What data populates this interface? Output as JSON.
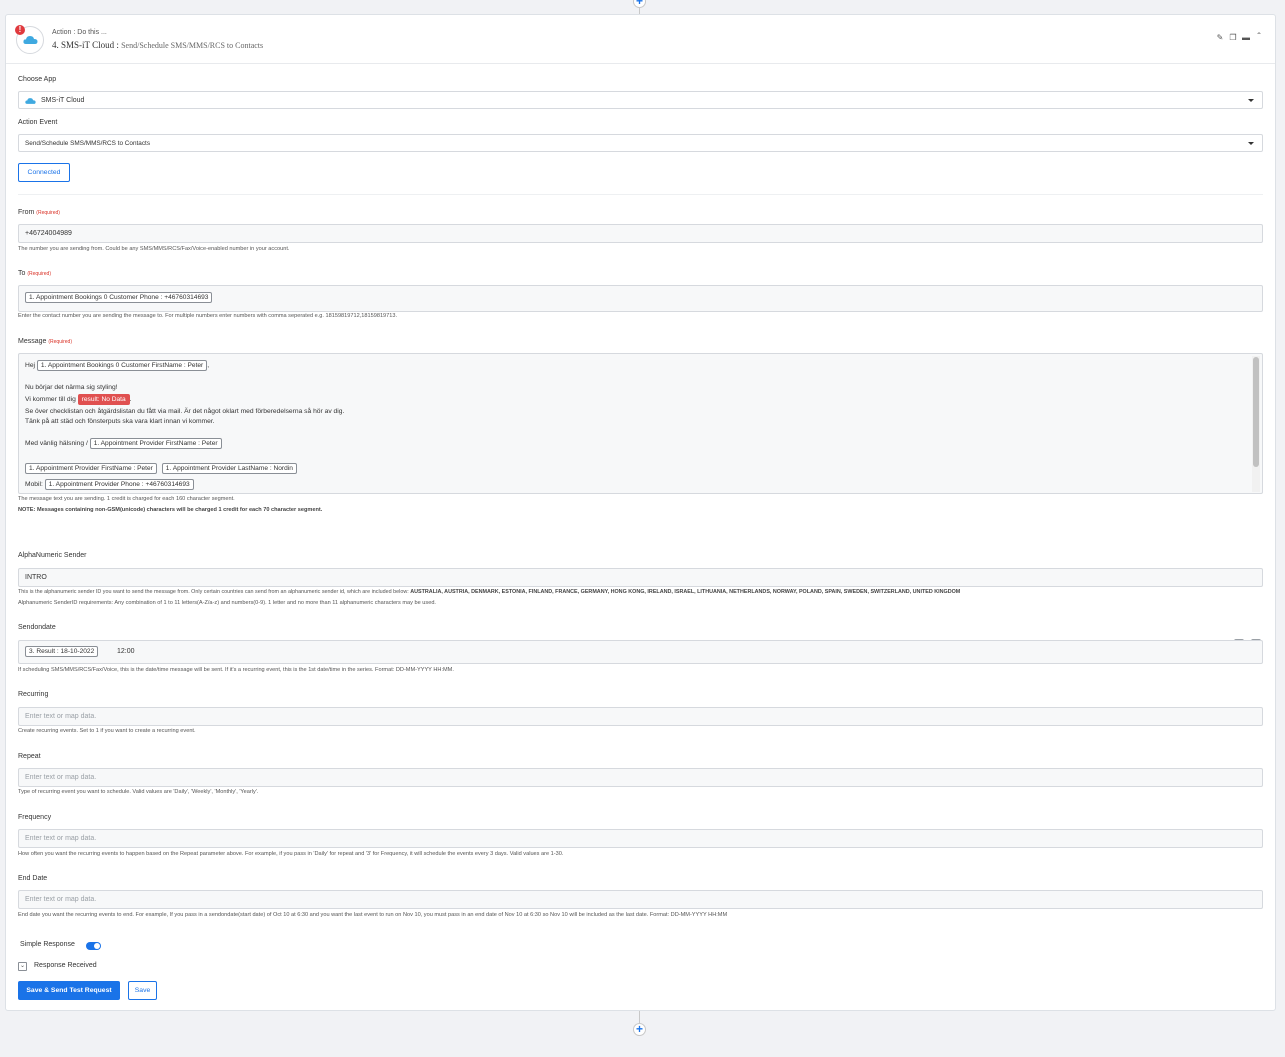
{
  "header": {
    "subtitle": "Action : Do this ...",
    "step_title": "4. SMS-iT Cloud :",
    "event_title": "Send/Schedule SMS/MMS/RCS to Contacts",
    "alert": "!"
  },
  "colors": {
    "accent": "#1a73e8",
    "error": "#e05050",
    "required": "#d93025"
  },
  "icons": {
    "logo": "cloud-icon",
    "edit": "pencil-icon",
    "copy": "copy-icon",
    "delete": "trash-icon",
    "collapse": "chevron-up-icon",
    "add": "plus-icon"
  },
  "choose_app": {
    "label": "Choose App",
    "value": "SMS-iT Cloud"
  },
  "action_event": {
    "label": "Action Event",
    "value": "Send/Schedule SMS/MMS/RCS to Contacts"
  },
  "connected_label": "Connected",
  "required_label": "(Required)",
  "from": {
    "label": "From",
    "value": "+46724004989",
    "hint": "The number you are sending from. Could be any SMS/MMS/RCS/Fax/Voice-enabled number in your account."
  },
  "to": {
    "label": "To",
    "pill": "1. Appointment Bookings 0 Customer Phone : +46760314693",
    "hint": "Enter the contact number you are sending the message to. For multiple numbers enter numbers with comma seperated e.g. 18159819712,18159819713."
  },
  "message": {
    "label": "Message",
    "hej": "Hej",
    "pill_firstname": "1. Appointment Bookings 0 Customer FirstName : Peter",
    "comma": ",",
    "line_styling": "Nu börjar det närma sig styling!",
    "line_vi": "Vi kommer till dig",
    "pill_nodata": "result: No Data",
    "period": ".",
    "line_se": "Se över checklistan och åtgärdslistan du fått via mail. Är det något oklart med förberedelserna så hör av dig.",
    "line_tank": "Tänk på att städ och fönsterputs ska vara klart innan vi kommer.",
    "line_med": "Med vänlig hälsning /",
    "pill_provider_first": "1. Appointment Provider FirstName : Peter",
    "pill_provider_first2": "1. Appointment Provider FirstName : Peter",
    "pill_provider_last": "1. Appointment Provider LastName : Nordin",
    "mobil": "Mobil:",
    "pill_provider_phone": "1. Appointment Provider Phone : +46760314693",
    "hint": "The message text you are sending. 1 credit is charged for each 160 character segment.",
    "note": "NOTE: Messages containing non-GSM(unicode) characters will be charged 1 credit for each 70 character segment."
  },
  "alpha": {
    "label": "AlphaNumeric Sender",
    "value": "INTRO",
    "hint_prefix": "This is the alphanumeric sender ID you want to send the message from. Only certain countries can send from an alphanumeric sender id, which are included below:",
    "countries": "AUSTRALIA, AUSTRIA, DENMARK, ESTONIA, FINLAND, FRANCE, GERMANY, HONG KONG, IRELAND, ISRAEL, LITHUANIA, NETHERLANDS, NORWAY, POLAND, SPAIN, SWEDEN, SWITZERLAND, UNITED KINGDOM",
    "hint2": "Alphanumeric SenderID requirements: Any combination of 1 to 11 letters(A-Z/a-z) and numbers(0-9). 1 letter and no more than 11 alphanumeric characters may be used."
  },
  "sendondate": {
    "label": "Sendondate",
    "pill": "3. Result : 18-10-2022",
    "time": "12:00",
    "minus": "−",
    "plus": "+",
    "hint": "If scheduling SMS/MMS/RCS/Fax/Voice, this is the date/time message will be sent. If it's a recurring event, this is the 1st date/time in the series. Format: DD-MM-YYYY HH:MM."
  },
  "placeholder": "Enter text or map data.",
  "recurring": {
    "label": "Recurring",
    "hint": "Create recurring events. Set to 1 if you want to create a recurring event."
  },
  "repeat": {
    "label": "Repeat",
    "hint": "Type of recurring event you want to schedule. Valid values are 'Daily', 'Weekly', 'Monthly', 'Yearly'."
  },
  "frequency": {
    "label": "Frequency",
    "hint": "How often you want the recurring events to happen based on the Repeat parameter above. For example, if you pass in 'Daily' for repeat and '3' for Frequency, it will schedule the events every 3 days. Valid values are 1-30."
  },
  "end_date": {
    "label": "End Date",
    "hint": "End date you want the recurring events to end. For example, If you pass in a sendondate(start date) of Oct 10 at 6:30 and you want the last event to run on Nov 10, you must pass in an end date of Nov 10 at 6:30 so Nov 10 will be included as the last date. Format: DD-MM-YYYY HH:MM"
  },
  "simple_response": {
    "label": "Simple Response",
    "on": true
  },
  "response_received": {
    "label": "Response Received",
    "chevron": "⌄"
  },
  "buttons": {
    "save_send": "Save & Send Test Request",
    "save": "Save"
  }
}
